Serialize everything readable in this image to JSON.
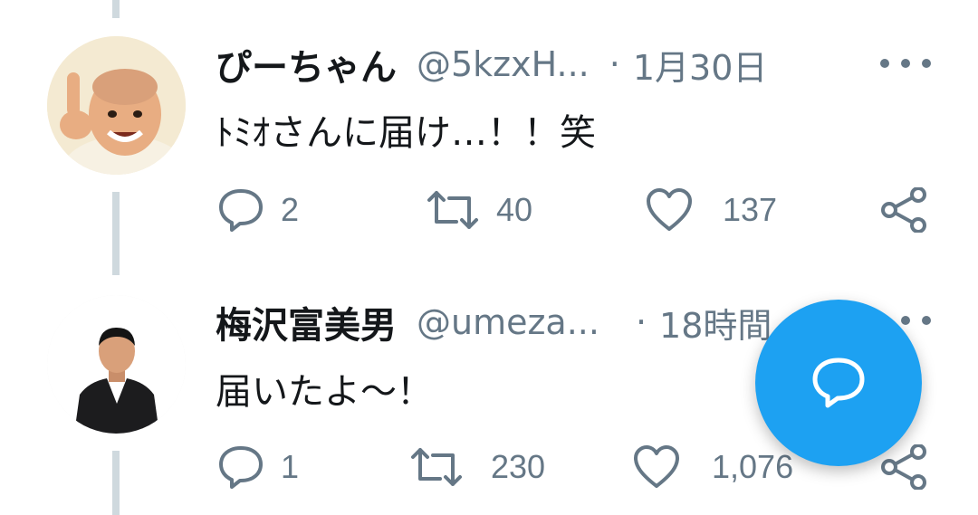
{
  "tweets": [
    {
      "name": "ぴーちゃん",
      "handle": "@5kzxH...",
      "separator": "·",
      "time": "1月30日",
      "text": "ﾄﾐｵさんに届け…！！笑",
      "replies": "2",
      "retweets": "40",
      "likes": "137",
      "avatar_icon": "person-pointing-avatar"
    },
    {
      "name": "梅沢富美男",
      "handle": "@umeza...",
      "separator": "·",
      "time": "18時間",
      "text": "届いたよ〜！",
      "replies": "1",
      "retweets": "230",
      "likes": "1,076",
      "avatar_icon": "person-suit-avatar"
    }
  ],
  "fab": {
    "icon": "compose-reply-icon",
    "color": "#1da1f2"
  },
  "colors": {
    "secondary": "#657786",
    "thread": "#cfd9de",
    "text": "#14171a"
  }
}
